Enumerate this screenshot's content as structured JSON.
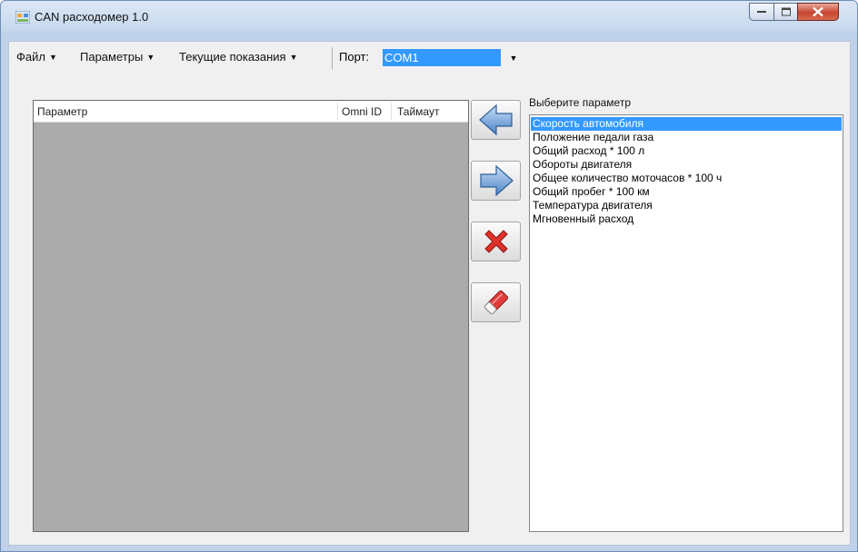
{
  "window": {
    "title": "CAN расходомер 1.0"
  },
  "menu": {
    "file": "Файл",
    "parameters": "Параметры",
    "readings": "Текущие показания",
    "port_label": "Порт:",
    "port_value": "COM1"
  },
  "grid": {
    "columns": [
      "Параметр",
      "Omni ID",
      "Таймаут"
    ],
    "rows": []
  },
  "toolbar": {
    "icons": [
      "arrow-left-icon",
      "arrow-right-icon",
      "delete-x-icon",
      "eraser-icon"
    ]
  },
  "param_list": {
    "label": "Выберите параметр",
    "selected_index": 0,
    "items": [
      "Скорость автомобиля",
      "Положение педали газа",
      "Общий расход * 100 л",
      "Обороты двигателя",
      "Общее количество моточасов * 100 ч",
      "Общий пробег * 100 км",
      "Температура двигателя",
      "Мгновенный расход"
    ]
  },
  "colors": {
    "selection": "#3399ff",
    "grid_background": "#ababab",
    "window_frame": "#c9daee"
  }
}
